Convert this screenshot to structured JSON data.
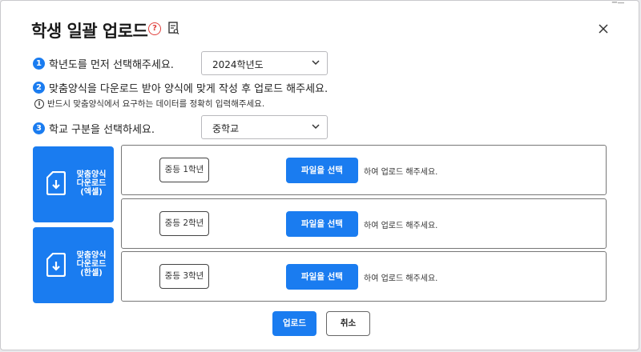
{
  "dialog": {
    "title": "학생 일괄 업로드",
    "help_icon_glyph": "?",
    "corner_text": "ー―"
  },
  "steps": [
    {
      "num": "1",
      "text": "학년도를 먼저 선택해주세요."
    },
    {
      "num": "2",
      "text": "맞춤양식을 다운로드 받아 양식에 맞게 작성 후 업로드 해주세요."
    },
    {
      "num": "3",
      "text": "학교 구분을 선택하세요."
    }
  ],
  "note": {
    "icon_glyph": "i",
    "text": "반드시 맞춤양식에서 요구하는 데이터를 정확히 입력해주세요."
  },
  "selects": {
    "year": {
      "value": "2024학년도"
    },
    "school_type": {
      "value": "중학교"
    }
  },
  "download_buttons": {
    "excel": {
      "line1": "맞춤양식",
      "line2": "다운로드",
      "line3": "(엑셀)"
    },
    "hwp": {
      "line1": "맞춤양식",
      "line2": "다운로드",
      "line3": "(한셀)"
    }
  },
  "grades": [
    {
      "label": "중등 1학년",
      "button": "파일을 선택",
      "hint": "하여 업로드 해주세요."
    },
    {
      "label": "중등 2학년",
      "button": "파일을 선택",
      "hint": "하여 업로드 해주세요."
    },
    {
      "label": "중등 3학년",
      "button": "파일을 선택",
      "hint": "하여 업로드 해주세요."
    }
  ],
  "footer": {
    "upload": "업로드",
    "cancel": "취소"
  },
  "colors": {
    "accent": "#1a7cf0",
    "help": "#e0413d"
  }
}
